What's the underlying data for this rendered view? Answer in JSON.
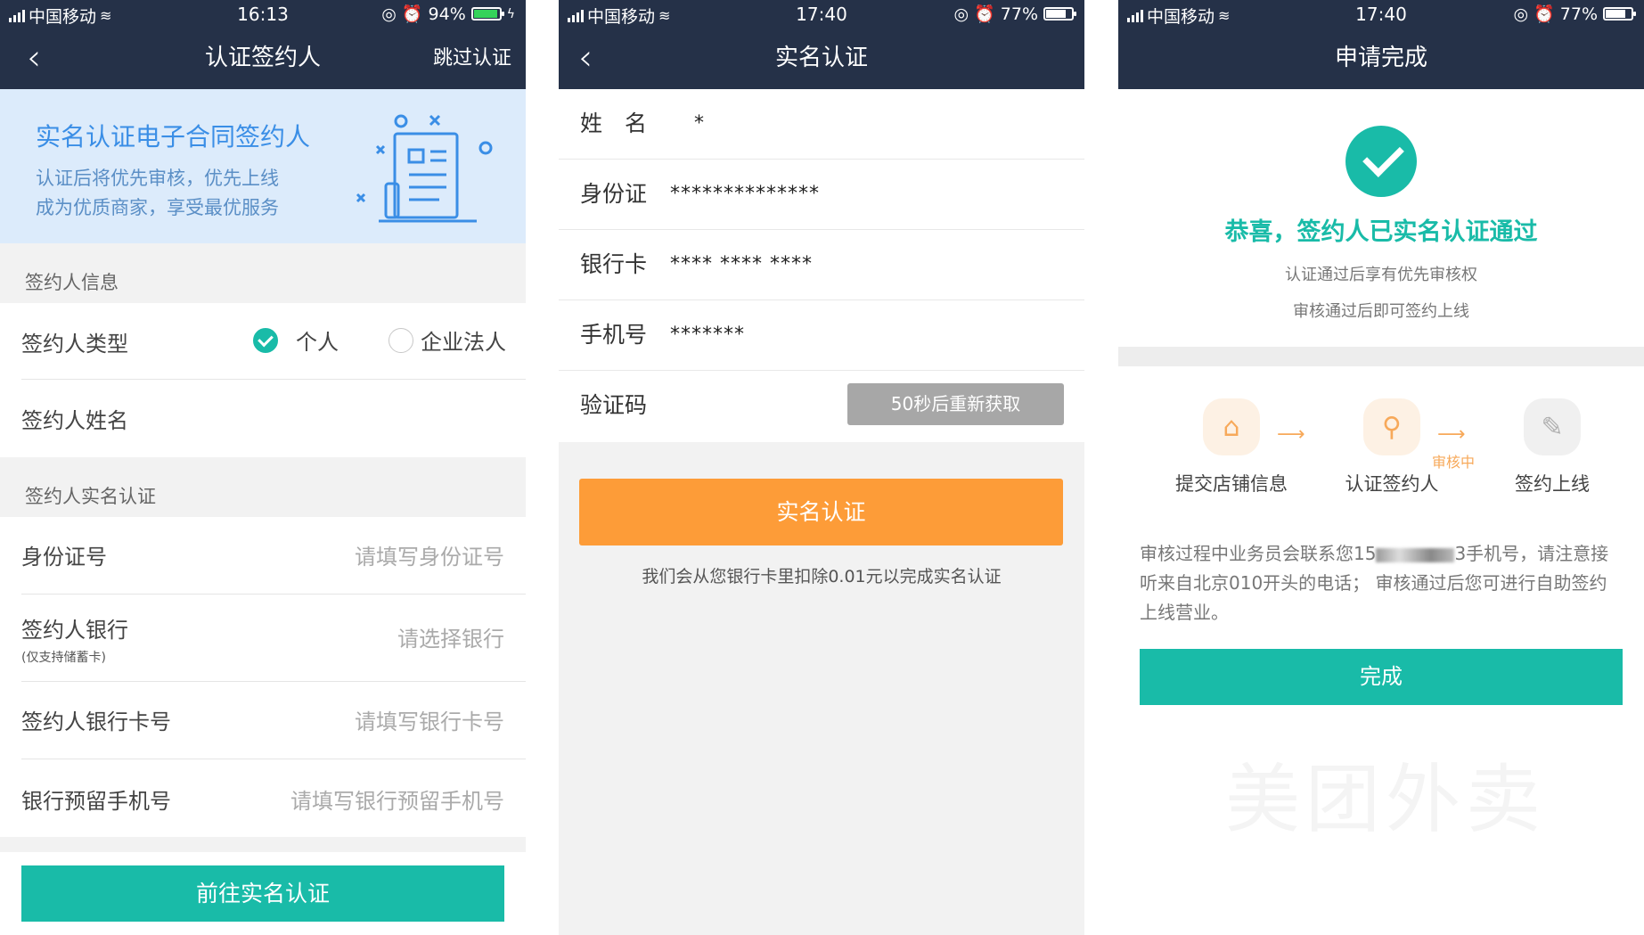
{
  "screen1": {
    "status": {
      "carrier": "中国移动",
      "time": "16:13",
      "battery": "94%"
    },
    "nav": {
      "back": "‹",
      "title": "认证签约人",
      "action": "跳过认证"
    },
    "banner": {
      "heading": "实名认证电子合同签约人",
      "line1": "认证后将优先审核，优先上线",
      "line2": "成为优质商家，享受最优服务"
    },
    "section1_title": "签约人信息",
    "type_label": "签约人类型",
    "option_personal": "个人",
    "option_enterprise": "企业法人",
    "name_label": "签约人姓名",
    "section2_title": "签约人实名认证",
    "id_label": "身份证号",
    "id_placeholder": "请填写身份证号",
    "bank_label": "签约人银行",
    "bank_note": "(仅支持储蓄卡)",
    "bank_placeholder": "请选择银行",
    "card_label": "签约人银行卡号",
    "card_placeholder": "请填写银行卡号",
    "phone_label": "银行预留手机号",
    "phone_placeholder": "请填写银行预留手机号",
    "submit": "前往实名认证"
  },
  "screen2": {
    "status": {
      "carrier": "中国移动",
      "time": "17:40",
      "battery": "77%"
    },
    "nav": {
      "back": "‹",
      "title": "实名认证"
    },
    "fields": [
      {
        "label": "姓　名",
        "value": "*"
      },
      {
        "label": "身份证",
        "value": "**************"
      },
      {
        "label": "银行卡",
        "value": "**** **** ****"
      },
      {
        "label": "手机号",
        "value": "*******"
      }
    ],
    "code_label": "验证码",
    "resend": "50秒后重新获取",
    "submit": "实名认证",
    "note": "我们会从您银行卡里扣除0.01元以完成实名认证"
  },
  "screen3": {
    "status": {
      "carrier": "中国移动",
      "time": "17:40",
      "battery": "77%"
    },
    "nav": {
      "title": "申请完成"
    },
    "congrats": "恭喜，签约人已实名认证通过",
    "sub1": "认证通过后享有优先审核权",
    "sub2": "审核通过后即可签约上线",
    "steps": [
      "提交店铺信息",
      "认证签约人",
      "签约上线"
    ],
    "arrow_label": "审核中",
    "desc_prefix": "审核过程中业务员会联系您15",
    "desc_suffix": "3手机号，请注意接听来自北京010开头的电话； 审核通过后您可进行自助签约上线营业。",
    "done": "完成",
    "watermark": "美团外卖"
  }
}
